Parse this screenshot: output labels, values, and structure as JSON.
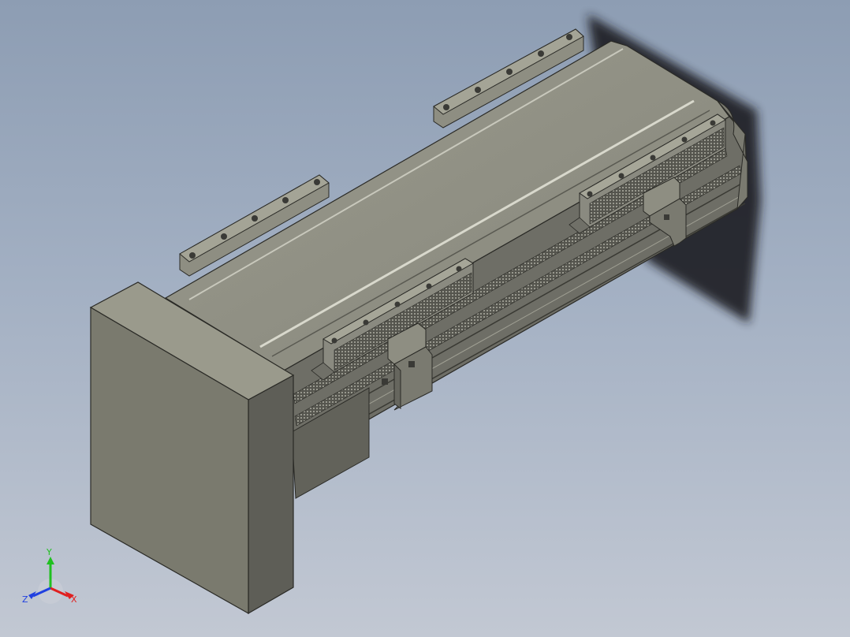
{
  "viewport": {
    "background_top": "#8d9db3",
    "background_bottom": "#c2c8d3"
  },
  "model": {
    "body_color": "#8a8a80",
    "dark_face_color": "#66665e",
    "light_face_color": "#979789",
    "edge_color": "#2a2a26",
    "shadow_color": "#20232a"
  },
  "triad": {
    "axes": [
      {
        "name": "x",
        "label": "X",
        "color": "#e02020"
      },
      {
        "name": "y",
        "label": "Y",
        "color": "#20c020"
      },
      {
        "name": "z",
        "label": "Z",
        "color": "#2040e0"
      }
    ]
  }
}
